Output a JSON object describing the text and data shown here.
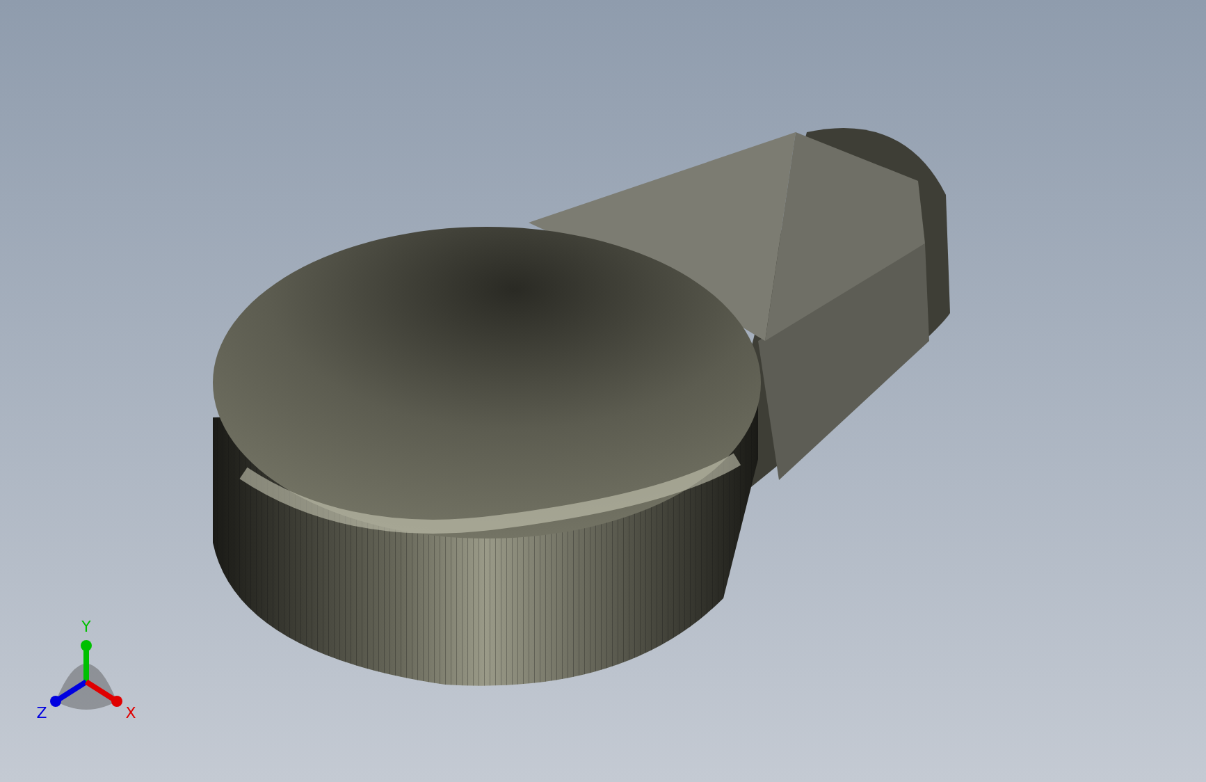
{
  "triad": {
    "axes": [
      {
        "label": "Y",
        "color": "#00c000"
      },
      {
        "label": "Z",
        "color": "#0000e0"
      },
      {
        "label": "X",
        "color": "#e00000"
      }
    ]
  }
}
